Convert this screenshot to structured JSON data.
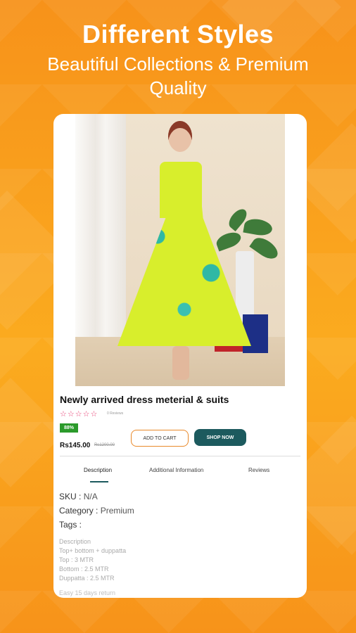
{
  "promo": {
    "title": "Different Styles",
    "subtitle": "Beautiful Collections & Premium Quality"
  },
  "product": {
    "name": "Newly arrived dress meterial & suits",
    "rating_stars": "☆☆☆☆☆",
    "reviews_text": "0 Reviews",
    "discount_badge": "88%",
    "price": "Rs145.00",
    "old_price": "Rs1200.00",
    "add_to_cart_label": "ADD TO CART",
    "shop_now_label": "SHOP NOW"
  },
  "tabs": [
    {
      "label": "Description",
      "active": true
    },
    {
      "label": "Additional Information",
      "active": false
    },
    {
      "label": "Reviews",
      "active": false
    }
  ],
  "details": {
    "sku_label": "SKU :",
    "sku_value": "N/A",
    "category_label": "Category :",
    "category_value": "Premium",
    "tags_label": "Tags :"
  },
  "description": {
    "heading": "Description",
    "lines": [
      "Top+ bottom + duppatta",
      "Top : 3 MTR",
      "Bottom : 2.5 MTR",
      "Duppatta : 2.5 MTR"
    ],
    "footer_text": "Easy 15 days return"
  },
  "colors": {
    "background": "#f99a18",
    "shop_button": "#1c5a5e",
    "badge": "#2b9a2b",
    "stars": "#e63a6f"
  }
}
